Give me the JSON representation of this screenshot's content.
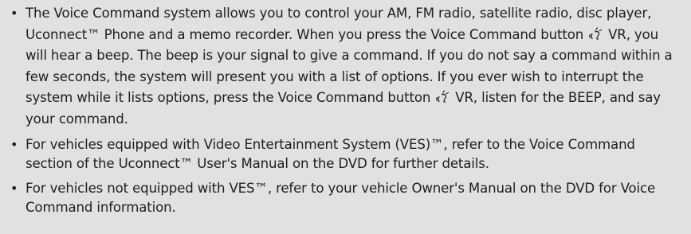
{
  "bullets": [
    {
      "parts": [
        "The Voice Command system allows you to control your AM, FM radio, satellite radio, disc player, Uconnect™ Phone and a memo recorder. When you press the Voice Command button",
        ", you will hear a beep. The beep is your signal to give a command. If you do not say a command within a few seconds, the system will present you with a list of options. If you ever wish to interrupt the system while it lists options, press the Voice Command button",
        ", listen for the BEEP, and say your command."
      ],
      "button_icon": "voice-command-icon",
      "button_label": "VR"
    },
    {
      "text": "For vehicles equipped with Video Entertainment System (VES)™, refer to the Voice Command section of the Uconnect™ User's Manual on the DVD for further details."
    },
    {
      "text": "For vehicles not equipped with VES™, refer to your vehicle Owner's Manual on the DVD for Voice Command information."
    }
  ],
  "colors": {
    "background": "#dfe1e3",
    "text": "#1e1e1e"
  }
}
